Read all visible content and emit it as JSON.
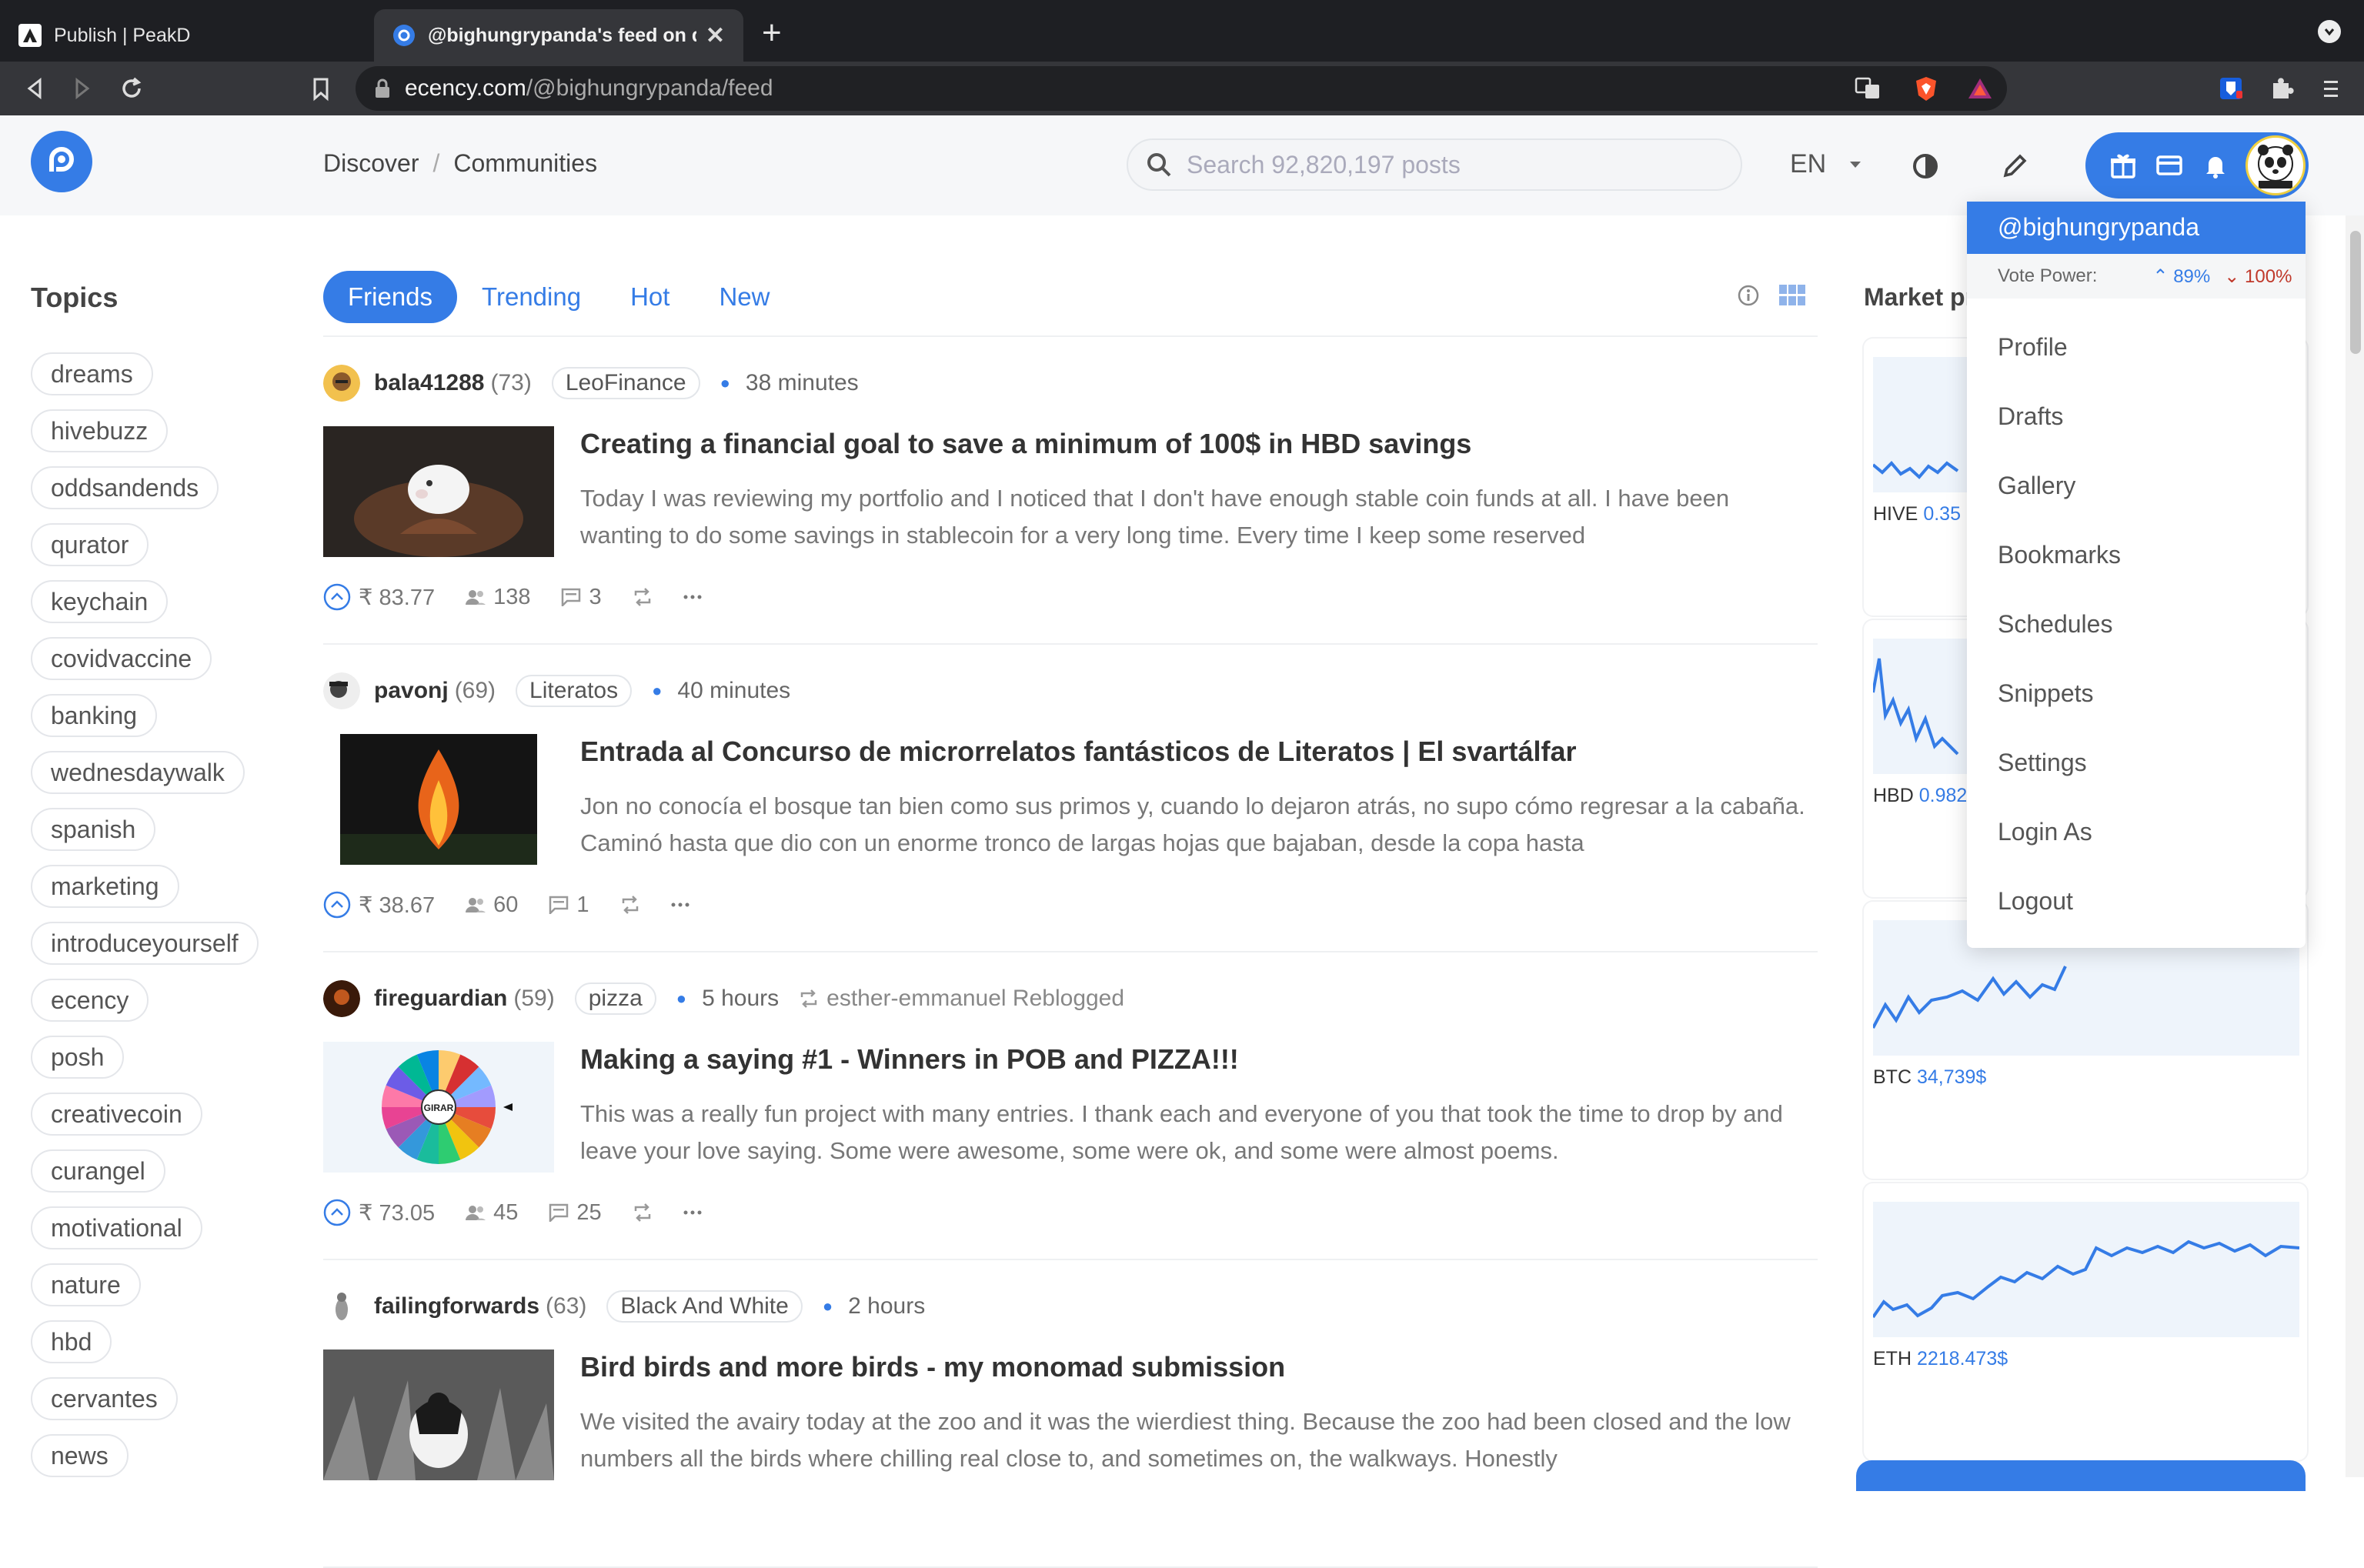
{
  "browser": {
    "tabs": [
      {
        "title": "Publish | PeakD",
        "active": false
      },
      {
        "title": "@bighungrypanda's feed on de",
        "active": true
      }
    ],
    "url_host": "ecency.com",
    "url_path": "/@bighungrypanda/feed"
  },
  "header": {
    "breadcrumb": [
      "Discover",
      "Communities"
    ],
    "breadcrumb_sep": "/",
    "search_placeholder": "Search 92,820,197 posts",
    "language": "EN"
  },
  "topics": {
    "heading": "Topics",
    "items": [
      "dreams",
      "hivebuzz",
      "oddsandends",
      "qurator",
      "keychain",
      "covidvaccine",
      "banking",
      "wednesdaywalk",
      "spanish",
      "marketing",
      "introduceyourself",
      "ecency",
      "posh",
      "creativecoin",
      "curangel",
      "motivational",
      "nature",
      "hbd",
      "cervantes",
      "news"
    ]
  },
  "feed_tabs": [
    "Friends",
    "Trending",
    "Hot",
    "New"
  ],
  "posts": [
    {
      "author": "bala41288",
      "rep": "(73)",
      "community": "LeoFinance",
      "time": "38 minutes",
      "reblog": "",
      "title": "Creating a financial goal to save a minimum of 100$ in HBD savings",
      "summary": "Today I was reviewing my portfolio and I noticed that I don't have enough stable coin funds at all. I have been wanting to do some savings in stablecoin for a very long time. Every time I keep some reserved",
      "payout": "₹ 83.77",
      "votes": "138",
      "comments": "3"
    },
    {
      "author": "pavonj",
      "rep": "(69)",
      "community": "Literatos",
      "time": "40 minutes",
      "reblog": "",
      "title": "Entrada al Concurso de microrrelatos fantásticos de Literatos | El svartálfar",
      "summary": "Jon no conocía el bosque tan bien como sus primos y, cuando lo dejaron atrás, no supo cómo regresar a la cabaña. Caminó hasta que dio con un enorme tronco de largas hojas que bajaban, desde la copa hasta",
      "payout": "₹ 38.67",
      "votes": "60",
      "comments": "1"
    },
    {
      "author": "fireguardian",
      "rep": "(59)",
      "community": "pizza",
      "time": "5 hours",
      "reblog": "esther-emmanuel Reblogged",
      "title": "Making a saying #1 - Winners in POB and PIZZA!!!",
      "summary": "This was a really fun project with many entries. I thank each and everyone of you that took the time to drop by and leave your love saying. Some were awesome, some were ok, and some were almost poems.",
      "payout": "₹ 73.05",
      "votes": "45",
      "comments": "25"
    },
    {
      "author": "failingforwards",
      "rep": "(63)",
      "community": "Black And White",
      "time": "2 hours",
      "reblog": "",
      "title": "Bird birds and more birds - my monomad submission",
      "summary": "We visited the avairy today at the zoo and it was the wierdiest thing. Because the zoo had been closed and the low numbers all the birds where chilling real close to, and sometimes on, the walkways. Honestly",
      "payout": "",
      "votes": "",
      "comments": ""
    }
  ],
  "wheel_label": "GIRAR",
  "market": {
    "heading": "Market pr",
    "cards": [
      {
        "symbol": "HIVE",
        "price": "0.35"
      },
      {
        "symbol": "HBD",
        "price": "0.982"
      },
      {
        "symbol": "BTC",
        "price": "34,739$"
      },
      {
        "symbol": "ETH",
        "price": "2218.473$"
      }
    ]
  },
  "user_menu": {
    "username": "@bighungrypanda",
    "vote_power_label": "Vote Power:",
    "vote_up": "89%",
    "vote_down": "100%",
    "items": [
      "Profile",
      "Drafts",
      "Gallery",
      "Bookmarks",
      "Schedules",
      "Snippets",
      "Settings",
      "Login As",
      "Logout"
    ]
  },
  "colors": {
    "accent": "#357ce6",
    "header_bg": "#f6f7f9",
    "downvote": "#c0392b"
  }
}
